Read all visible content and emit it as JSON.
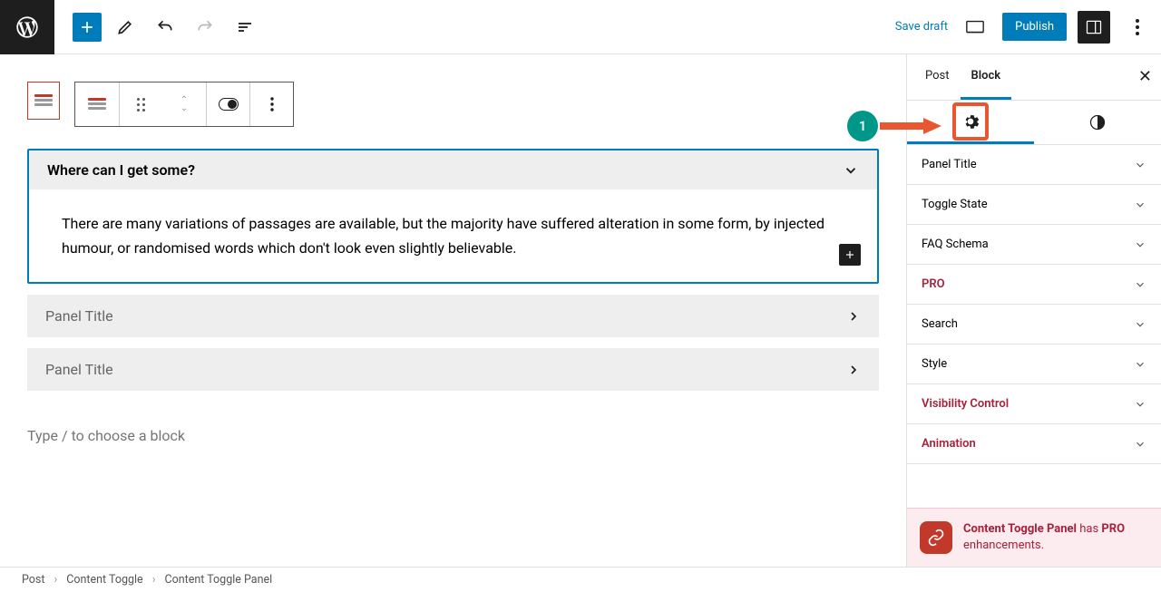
{
  "topbar": {
    "save_draft": "Save draft",
    "publish": "Publish"
  },
  "editor": {
    "panel1_title": "Where can I get some?",
    "panel1_body": "There are many variations of passages are available, but the majority have suffered alteration in some form, by injected humour, or randomised words which don't look even slightly believable.",
    "panel2_title": "Panel Title",
    "panel3_title": "Panel Title",
    "placeholder": "Type / to choose a block"
  },
  "sidebar": {
    "tabs": {
      "post": "Post",
      "block": "Block"
    },
    "panels": [
      {
        "label": "Panel Title",
        "red": false
      },
      {
        "label": "Toggle State",
        "red": false
      },
      {
        "label": "FAQ Schema",
        "red": false
      },
      {
        "label": "PRO",
        "red": true
      },
      {
        "label": "Search",
        "red": false
      },
      {
        "label": "Style",
        "red": false
      },
      {
        "label": "Visibility Control",
        "red": true
      },
      {
        "label": "Animation",
        "red": true
      }
    ],
    "banner": {
      "title": "Content Toggle Panel",
      "has": " has ",
      "pro": "PRO",
      "rest": " enhancements."
    }
  },
  "breadcrumb": [
    "Post",
    "Content Toggle",
    "Content Toggle Panel"
  ],
  "annotation": {
    "number": "1"
  }
}
